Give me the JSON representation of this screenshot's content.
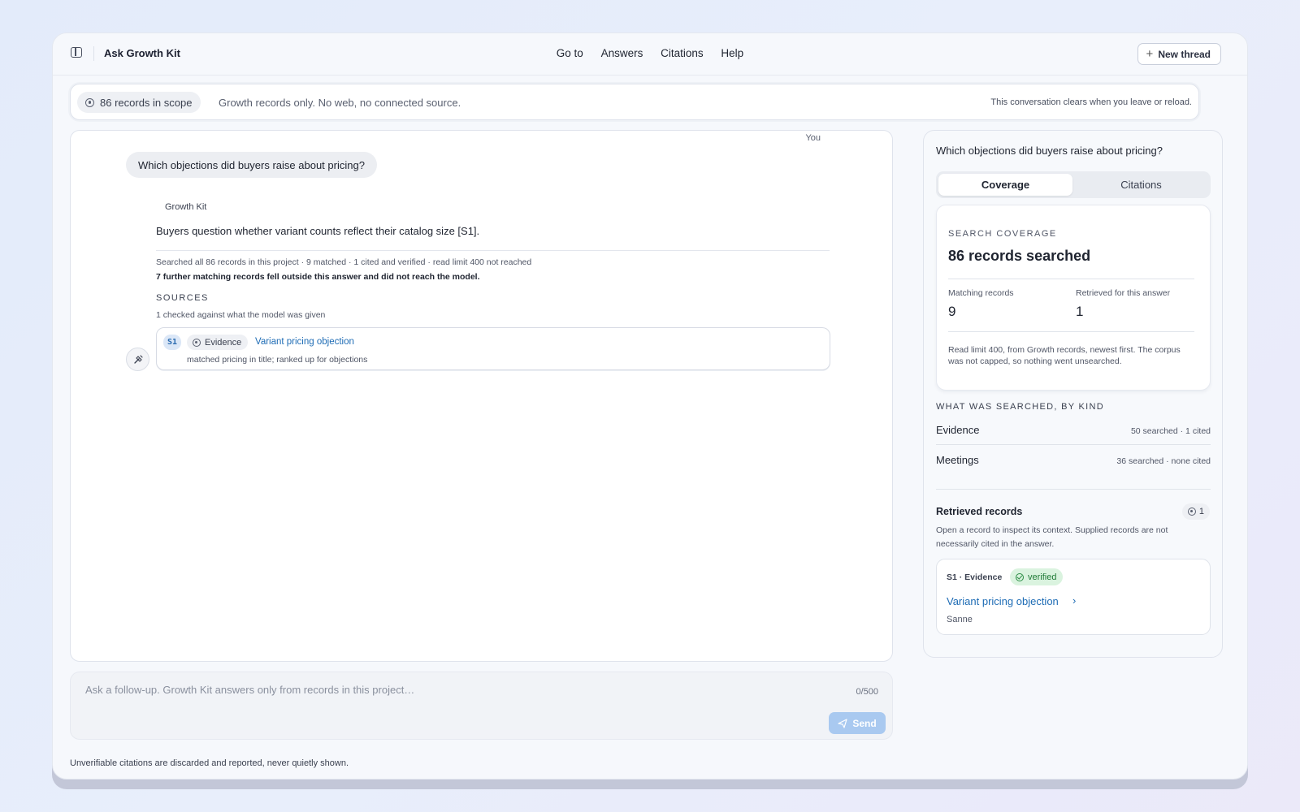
{
  "app": {
    "title": "Ask Growth Kit",
    "nav": [
      "Go to",
      "Answers",
      "Citations",
      "Help"
    ],
    "new_thread_label": "New thread"
  },
  "scope": {
    "chip_label": "86 records in scope",
    "description": "Growth records only. No web, no connected source.",
    "note": "This conversation clears when you leave or reload."
  },
  "chat": {
    "you_label": "You",
    "user_message": "Which objections did buyers raise about pricing?",
    "assistant_name": "Growth Kit",
    "answer": "Buyers question whether variant counts reflect their catalog size [S1].",
    "search_meta": "Searched all 86 records in this project · 9 matched · 1 cited and verified · read limit 400 not reached",
    "further_note": "7 further matching records fell outside this answer and did not reach the model.",
    "sources_heading": "SOURCES",
    "sources_sub": "1 checked against what the model was given",
    "source": {
      "id": "S1",
      "kind": "Evidence",
      "title": "Variant pricing objection",
      "reason": "matched pricing in title; ranked up for objections"
    }
  },
  "composer": {
    "placeholder": "Ask a follow-up. Growth Kit answers only from records in this project…",
    "value": "",
    "char_count": "0/500",
    "send_label": "Send",
    "footnote": "Unverifiable citations are discarded and reported, never quietly shown."
  },
  "side": {
    "question": "Which objections did buyers raise about pricing?",
    "tabs": [
      "Coverage",
      "Citations"
    ],
    "active_tab": "Coverage",
    "coverage": {
      "eyebrow": "SEARCH COVERAGE",
      "headline": "86 records searched",
      "matching_label": "Matching records",
      "matching_value": "9",
      "retrieved_label": "Retrieved for this answer",
      "retrieved_value": "1",
      "note": "Read limit 400, from Growth records, newest first. The corpus was not capped, so nothing went unsearched."
    },
    "by_kind_heading": "WHAT WAS SEARCHED, BY KIND",
    "kinds": [
      {
        "name": "Evidence",
        "stat": "50 searched · 1 cited"
      },
      {
        "name": "Meetings",
        "stat": "36 searched · none cited"
      }
    ],
    "retrieved": {
      "heading": "Retrieved records",
      "count": "1",
      "note": "Open a record to inspect its context. Supplied records are not necessarily cited in the answer.",
      "record": {
        "meta": "S1 · Evidence",
        "status": "verified",
        "title": "Variant pricing objection",
        "author": "Sanne"
      }
    }
  },
  "colors": {
    "accent_link": "#1e6cb5",
    "verified_bg": "#daf3df",
    "send_disabled": "#a9c9f0"
  },
  "icons": [
    "sidebar-toggle-icon",
    "plus-icon",
    "scope-icon",
    "tools-icon",
    "send-icon",
    "check-circle-icon",
    "chevron-right-icon"
  ]
}
